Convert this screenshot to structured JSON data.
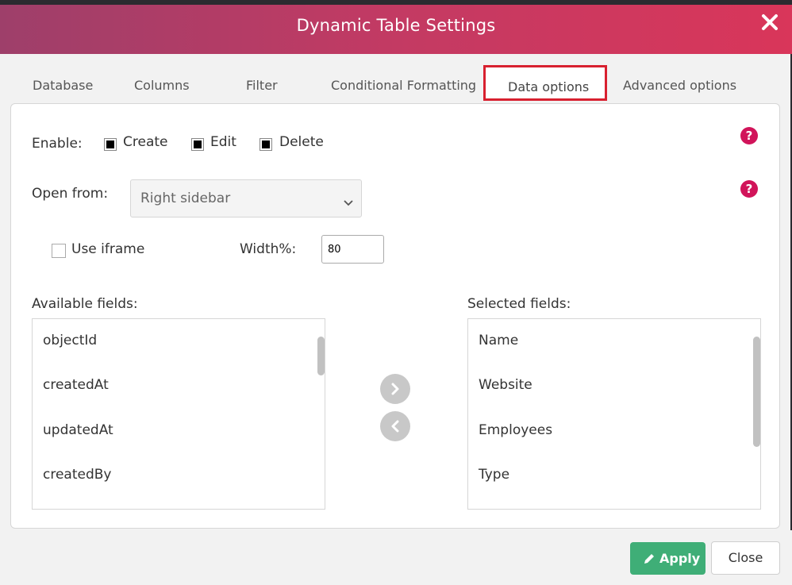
{
  "dialog": {
    "title": "Dynamic Table Settings"
  },
  "tabs": [
    {
      "label": "Database"
    },
    {
      "label": "Columns"
    },
    {
      "label": "Filter"
    },
    {
      "label": "Conditional Formatting"
    },
    {
      "label": "Data options",
      "active": true
    },
    {
      "label": "Advanced options"
    }
  ],
  "enable": {
    "label": "Enable:",
    "create": {
      "label": "Create",
      "checked": true
    },
    "edit": {
      "label": "Edit",
      "checked": true
    },
    "delete": {
      "label": "Delete",
      "checked": true
    }
  },
  "open_from": {
    "label": "Open from:",
    "selected": "Right sidebar"
  },
  "use_iframe": {
    "label": "Use iframe",
    "checked": false
  },
  "width": {
    "label": "Width%:",
    "value": "80"
  },
  "available_fields": {
    "label": "Available fields:",
    "items": [
      "objectId",
      "createdAt",
      "updatedAt",
      "createdBy"
    ]
  },
  "selected_fields": {
    "label": "Selected fields:",
    "items": [
      "Name",
      "Website",
      "Employees",
      "Type"
    ]
  },
  "help_icon": "?",
  "footer": {
    "apply_label": "Apply",
    "close_label": "Close"
  },
  "colors": {
    "header_gradient_start": "#9e3f6a",
    "header_gradient_end": "#d9365a",
    "active_tab_border": "#d8202f",
    "help_icon": "#d1145a",
    "apply_button": "#3fae77"
  }
}
